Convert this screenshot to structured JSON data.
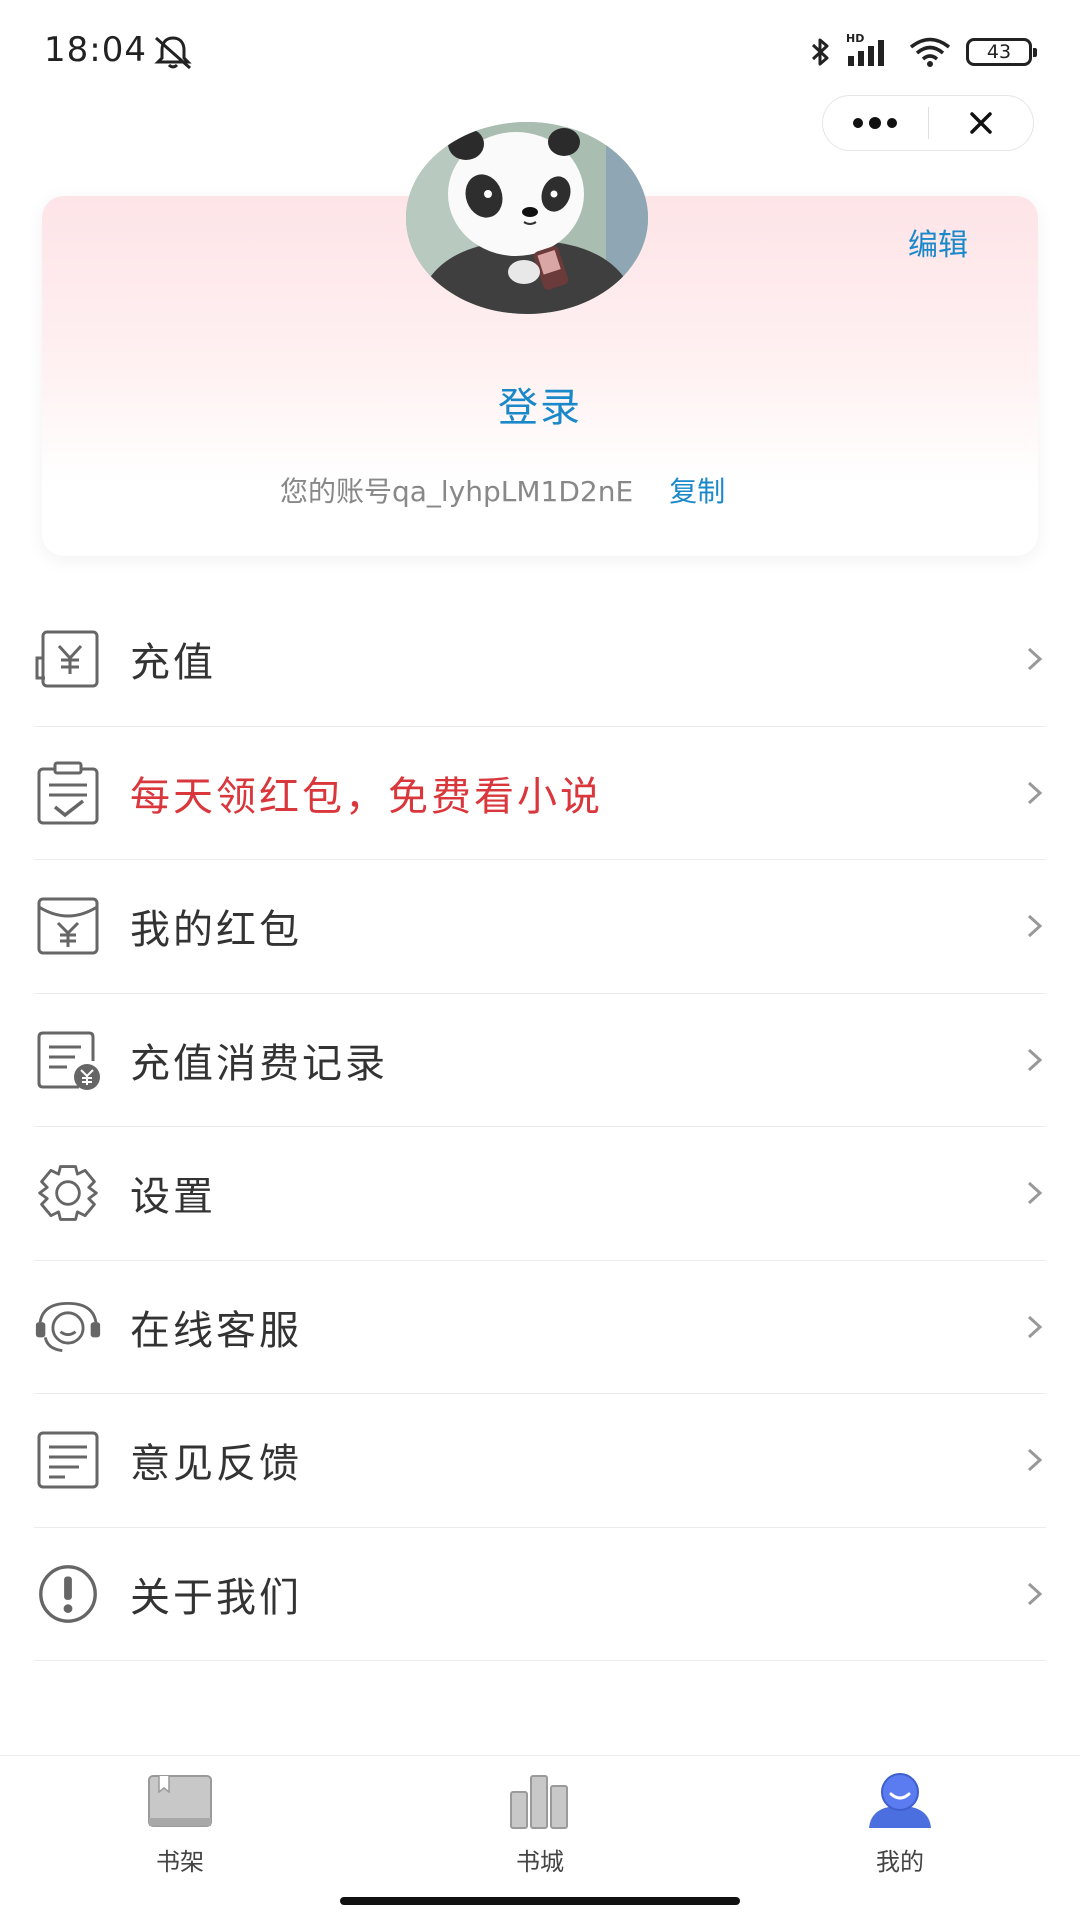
{
  "status_bar": {
    "time": "18:04",
    "signal_label": "HD",
    "battery": "43"
  },
  "capsule": {
    "more_icon": "more-dots-icon",
    "close_icon": "close-icon"
  },
  "profile": {
    "edit_label": "编辑",
    "login_label": "登录",
    "account_text": "您的账号qa_lyhpLM1D2nE",
    "copy_label": "复制"
  },
  "menu": {
    "items": [
      {
        "label": "充值",
        "icon": "recharge-icon"
      },
      {
        "label": "每天领红包，免费看小说",
        "icon": "task-clipboard-icon",
        "highlight": true
      },
      {
        "label": "我的红包",
        "icon": "red-envelope-icon"
      },
      {
        "label": "充值消费记录",
        "icon": "records-icon"
      },
      {
        "label": "设置",
        "icon": "gear-icon"
      },
      {
        "label": "在线客服",
        "icon": "headset-icon"
      },
      {
        "label": "意见反馈",
        "icon": "feedback-icon"
      },
      {
        "label": "关于我们",
        "icon": "info-icon"
      }
    ]
  },
  "tab_bar": {
    "tabs": [
      {
        "label": "书架",
        "icon": "bookshelf-icon"
      },
      {
        "label": "书城",
        "icon": "bookstore-icon"
      },
      {
        "label": "我的",
        "icon": "profile-icon",
        "active": true
      }
    ]
  },
  "colors": {
    "link": "#1a88c9",
    "highlight": "#d9373c",
    "active_tab": "#4c6fe0"
  }
}
